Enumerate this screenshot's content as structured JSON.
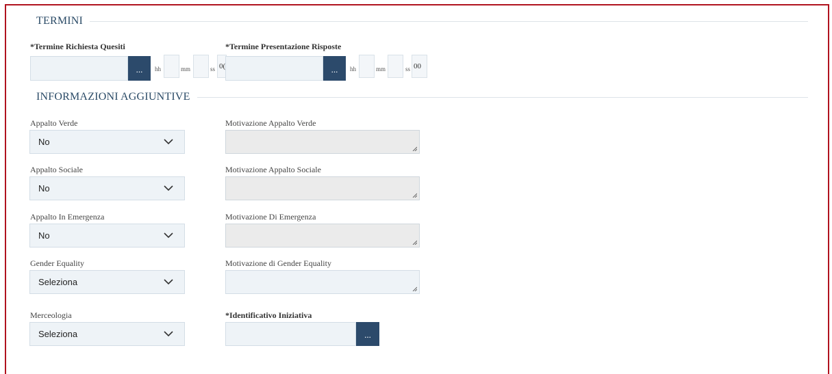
{
  "termini": {
    "title": "TERMINI",
    "richiesta_quesiti": {
      "label": "*Termine Richiesta Quesiti",
      "date_value": "",
      "button_label": "...",
      "hh_label": "hh",
      "mm_label": "mm",
      "ss_label": "ss",
      "ss_value": "0("
    },
    "presentazione_risposte": {
      "label": "*Termine Presentazione Risposte",
      "date_value": "",
      "button_label": "...",
      "hh_label": "hh",
      "mm_label": "mm",
      "ss_label": "ss",
      "ss_value": "00"
    }
  },
  "info": {
    "title": "INFORMAZIONI AGGIUNTIVE",
    "appalto_verde": {
      "label": "Appalto Verde",
      "value": "No"
    },
    "motivazione_verde": {
      "label": "Motivazione Appalto Verde"
    },
    "appalto_sociale": {
      "label": "Appalto Sociale",
      "value": "No"
    },
    "motivazione_sociale": {
      "label": "Motivazione Appalto Sociale"
    },
    "appalto_emergenza": {
      "label": "Appalto In Emergenza",
      "value": "No"
    },
    "motivazione_emergenza": {
      "label": "Motivazione Di Emergenza"
    },
    "gender_equality": {
      "label": "Gender Equality",
      "value": "Seleziona"
    },
    "motivazione_gender": {
      "label": "Motivazione di Gender Equality"
    },
    "merceologia": {
      "label": "Merceologia",
      "value": "Seleziona"
    },
    "identificativo": {
      "label": "*Identificativo Iniziativa",
      "button_label": "..."
    }
  },
  "colors": {
    "frame_border": "#b0121e",
    "button_bg": "#2c4a6b",
    "field_bg": "#eef3f7",
    "disabled_bg": "#ebebeb",
    "section_title": "#2a4a66"
  }
}
